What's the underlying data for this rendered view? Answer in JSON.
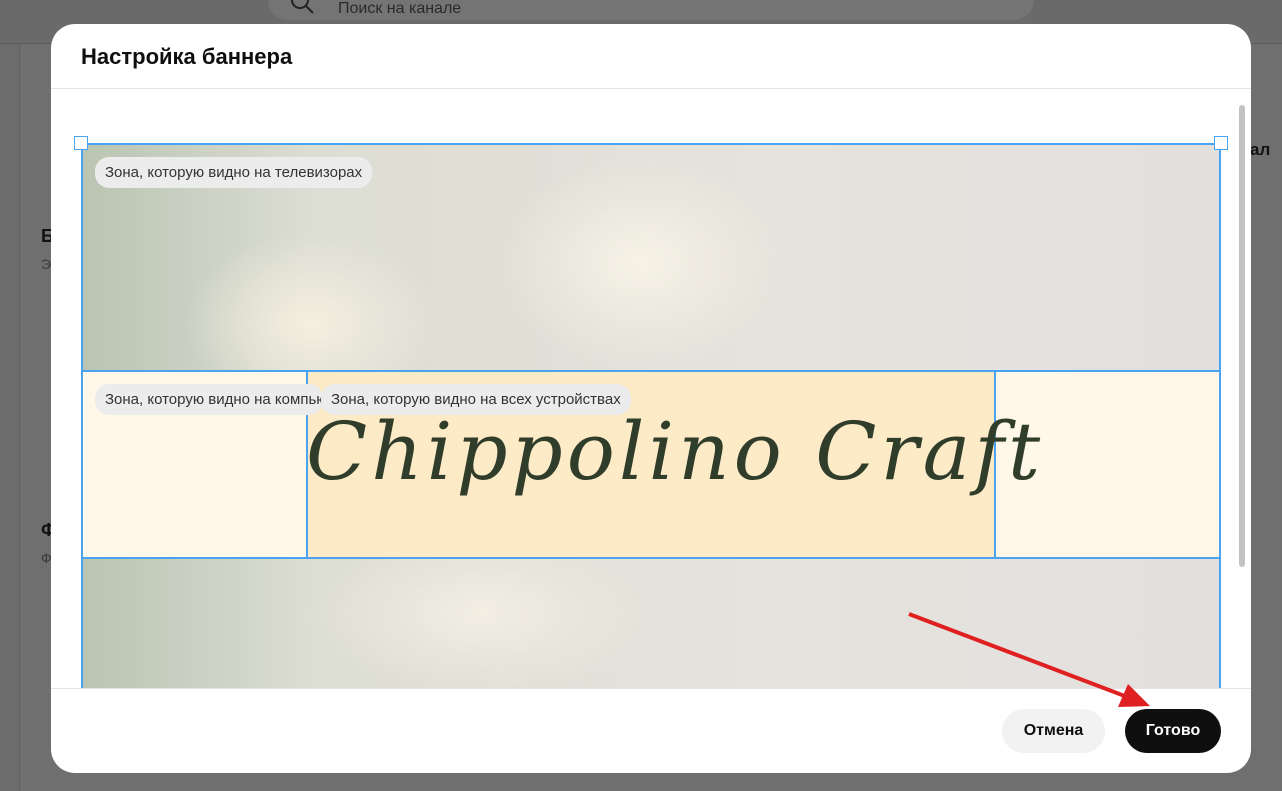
{
  "background": {
    "search_placeholder": "Поиск на канале",
    "left_heading_1": "Б",
    "left_sub_1": "Э",
    "left_heading_2": "Ф",
    "left_sub_2": "Ф",
    "right_fragment": "ал"
  },
  "modal": {
    "title": "Настройка баннера",
    "zones": {
      "tv": "Зона, которую видно на телевизорах",
      "desktop": "Зона, которую видно на компьютерах",
      "all": "Зона, которую видно на всех устройствах"
    },
    "banner_text": "Chippolino Craft",
    "cancel_label": "Отмена",
    "done_label": "Готово"
  },
  "colors": {
    "accent": "#4aa3f0",
    "annotation_arrow": "#e02020"
  }
}
